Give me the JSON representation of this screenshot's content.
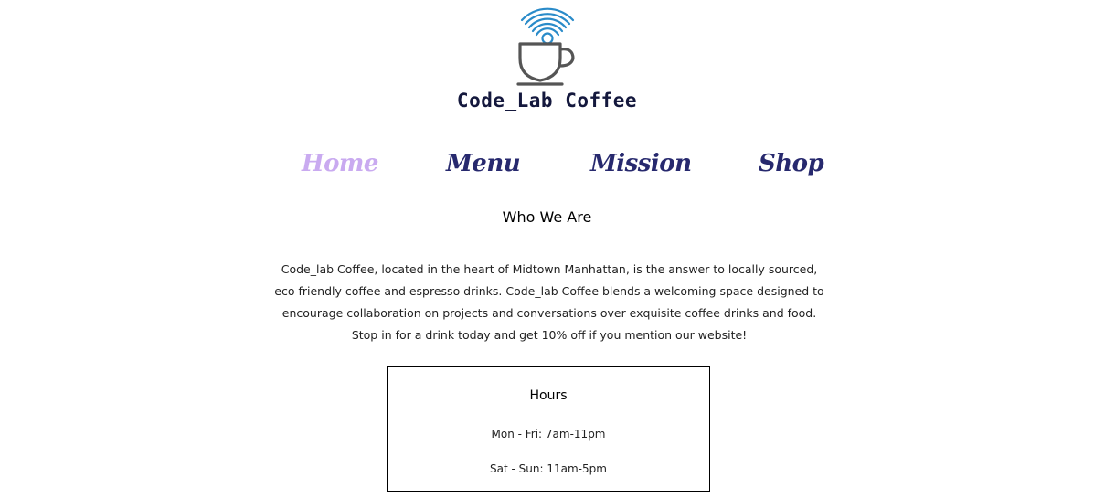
{
  "header": {
    "brand_name": "Code_Lab Coffee",
    "logo_icon": "coffee-cup-wifi-icon",
    "colors": {
      "wifi": "#2a8bc9",
      "cup": "#555555",
      "brand_text": "#14183d"
    }
  },
  "nav": {
    "items": [
      {
        "label": "Home",
        "active": true
      },
      {
        "label": "Menu",
        "active": false
      },
      {
        "label": "Mission",
        "active": false
      },
      {
        "label": "Shop",
        "active": false
      }
    ],
    "colors": {
      "active": "#c9aaf0",
      "default": "#27296e"
    }
  },
  "about": {
    "title": "Who We Are",
    "lines": [
      "Code_lab Coffee, located in the heart of Midtown Manhattan, is the answer to locally sourced,",
      "eco friendly coffee and espresso drinks. Code_lab Coffee blends a welcoming space designed to",
      "encourage collaboration on projects and conversations over exquisite coffee drinks and food.",
      "Stop in for a drink today and get 10% off if you mention our website!"
    ]
  },
  "hours": {
    "title": "Hours",
    "lines": [
      "Mon - Fri: 7am-11pm",
      "Sat - Sun: 11am-5pm"
    ]
  }
}
